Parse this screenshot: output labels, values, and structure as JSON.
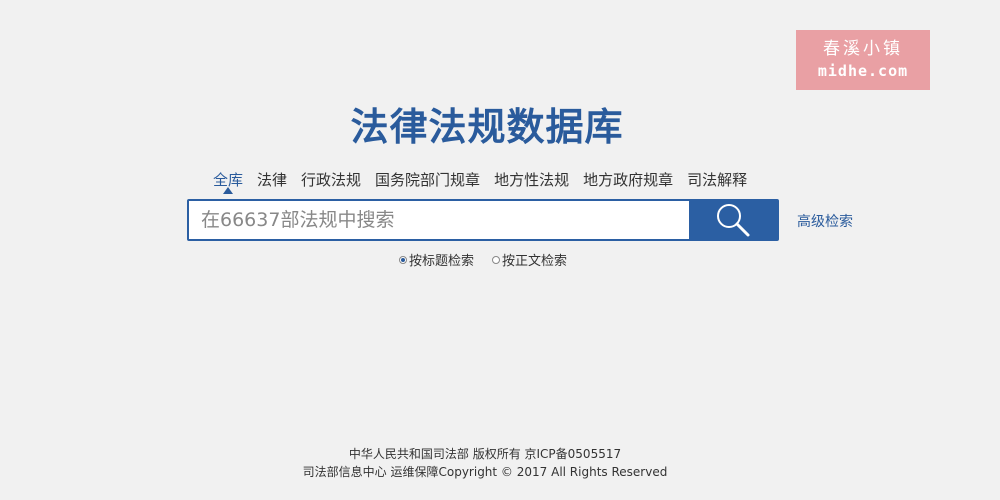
{
  "watermark": {
    "line1": "春溪小镇",
    "line2": "midhe.com"
  },
  "title": "法律法规数据库",
  "tabs": [
    {
      "label": "全库"
    },
    {
      "label": "法律"
    },
    {
      "label": "行政法规"
    },
    {
      "label": "国务院部门规章"
    },
    {
      "label": "地方性法规"
    },
    {
      "label": "地方政府规章"
    },
    {
      "label": "司法解释"
    }
  ],
  "active_tab": "全库",
  "search": {
    "placeholder": "在66637部法规中搜索",
    "value": ""
  },
  "advanced_search": "高级检索",
  "radios": [
    {
      "label": "按标题检索",
      "checked": true
    },
    {
      "label": "按正文检索",
      "checked": false
    }
  ],
  "footer": {
    "line1": "中华人民共和国司法部 版权所有 京ICP备0505517",
    "line2": "司法部信息中心 运维保障Copyright © 2017 All Rights Reserved"
  },
  "colors": {
    "accent": "#2a5b9c",
    "background": "#f1f1f1",
    "watermark": "#e9a0a4"
  }
}
